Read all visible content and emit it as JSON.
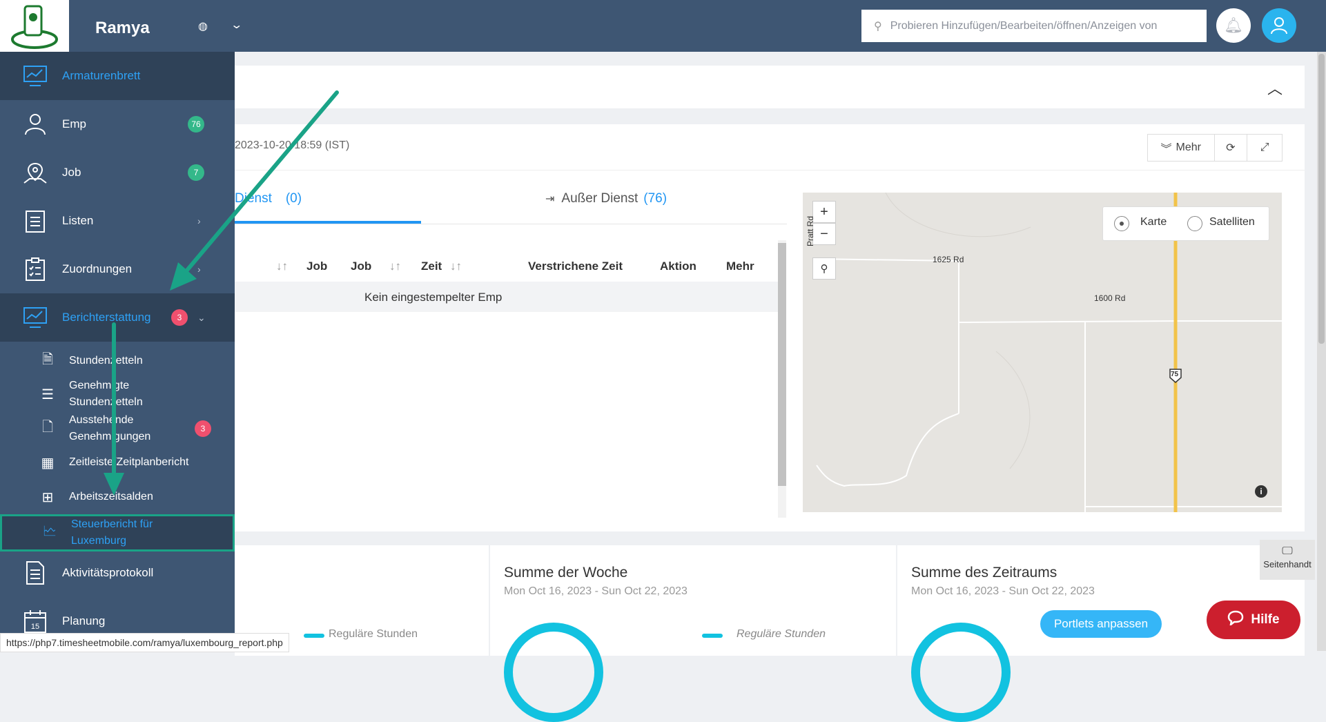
{
  "topbar": {
    "company": "Ramya",
    "search_placeholder": "Probieren Hinzufügen/Bearbeiten/öffnen/Anzeigen von"
  },
  "sidebar": {
    "items": [
      {
        "label": "Armaturenbrett"
      },
      {
        "label": "Emp",
        "badge": "76"
      },
      {
        "label": "Job",
        "badge": "7"
      },
      {
        "label": "Listen"
      },
      {
        "label": "Zuordnungen"
      },
      {
        "label": "Berichterstattung",
        "badge": "3"
      },
      {
        "label": "Aktivitätsprotokoll"
      },
      {
        "label": "Planung"
      }
    ],
    "subitems": [
      {
        "label": "Stundenzetteln"
      },
      {
        "label": "Genehmigte Stundenzetteln"
      },
      {
        "label": "Ausstehende Genehmigungen",
        "badge": "3"
      },
      {
        "label": "Zeitleiste/Zeitplanbericht"
      },
      {
        "label": "Arbeitszeitsalden"
      },
      {
        "label": "Steuerbericht für Luxemburg"
      }
    ]
  },
  "dashboard": {
    "date_text": "2023-10-20 18:59 (IST)",
    "buttons": {
      "mehr": "Mehr"
    },
    "tab_in": {
      "label": "Dienst",
      "count": "(0)"
    },
    "tab_out": {
      "label": "Außer Dienst",
      "count": "(76)"
    },
    "table_headers": [
      "Job",
      "Job",
      "Zeit",
      "Verstrichene Zeit",
      "Aktion",
      "Mehr"
    ],
    "empty_message": "Kein eingestempelter Emp"
  },
  "map": {
    "type_karte": "Karte",
    "type_satelliten": "Satelliten",
    "roads": [
      "Pratt Rd",
      "1625 Rd",
      "1600 Rd"
    ],
    "highway": "75"
  },
  "summary": {
    "legend": "Reguläre Stunden",
    "week": {
      "title": "Summe der Woche",
      "range": "Mon Oct 16, 2023 - Sun Oct 22, 2023"
    },
    "period": {
      "title": "Summe des Zeitraums",
      "range": "Mon Oct 16, 2023 - Sun Oct 22, 2023"
    }
  },
  "floating": {
    "status_url": "https://php7.timesheetmobile.com/ramya/luxembourg_report.php",
    "portlets": "Portlets anpassen",
    "hilfe": "Hilfe",
    "seitenhandbuch": "Seitenhandt"
  },
  "colors": {
    "sidebar": "#3e5673",
    "accent": "#2ea1f5",
    "annotation": "#1aa387",
    "hilfe": "#cc1f2e"
  }
}
